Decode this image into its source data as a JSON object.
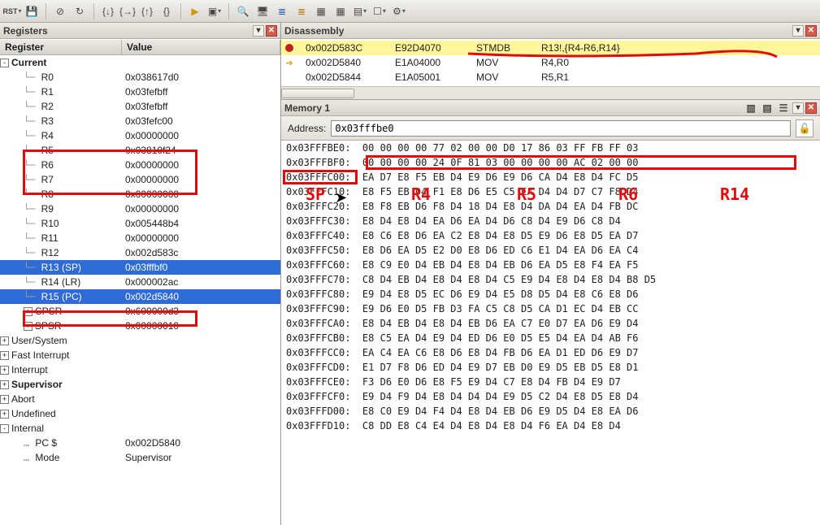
{
  "toolbar_icons": [
    "rst",
    "save",
    "stop",
    "sync",
    "step-into",
    "step-over",
    "step-out",
    "run-to",
    "play-dd",
    "box-dd",
    "search",
    "screen",
    "stack-blue",
    "stack-orange",
    "grid",
    "grid2",
    "table-dd",
    "window-dd",
    "gear-dd"
  ],
  "registers_panel": {
    "title": "Registers",
    "columns": {
      "register": "Register",
      "value": "Value"
    },
    "groups": [
      {
        "name": "Current",
        "expanded": true,
        "bold": true,
        "children": [
          {
            "name": "R0",
            "value": "0x038617d0"
          },
          {
            "name": "R1",
            "value": "0x03fefbff"
          },
          {
            "name": "R2",
            "value": "0x03fefbff"
          },
          {
            "name": "R3",
            "value": "0x03fefc00"
          },
          {
            "name": "R4",
            "value": "0x00000000"
          },
          {
            "name": "R5",
            "value": "0x03810f24"
          },
          {
            "name": "R6",
            "value": "0x00000000"
          },
          {
            "name": "R7",
            "value": "0x00000000"
          },
          {
            "name": "R8",
            "value": "0x00000000"
          },
          {
            "name": "R9",
            "value": "0x00000000"
          },
          {
            "name": "R10",
            "value": "0x005448b4"
          },
          {
            "name": "R11",
            "value": "0x00000000"
          },
          {
            "name": "R12",
            "value": "0x002d583c"
          },
          {
            "name": "R13 (SP)",
            "value": "0x03fffbf0",
            "sel": true
          },
          {
            "name": "R14 (LR)",
            "value": "0x000002ac"
          },
          {
            "name": "R15 (PC)",
            "value": "0x002d5840",
            "sel": true
          },
          {
            "name": "CPSR",
            "value": "0x600000d3",
            "exp": "+"
          },
          {
            "name": "SPSR",
            "value": "0x00000010",
            "exp": "+"
          }
        ]
      },
      {
        "name": "User/System",
        "expanded": false,
        "exp": "+",
        "prefix": "…"
      },
      {
        "name": "Fast Interrupt",
        "expanded": false,
        "exp": "+",
        "prefix": "…"
      },
      {
        "name": "Interrupt",
        "expanded": false,
        "exp": "+",
        "prefix": "…"
      },
      {
        "name": "Supervisor",
        "expanded": false,
        "exp": "+",
        "bold": true,
        "prefix": "…"
      },
      {
        "name": "Abort",
        "expanded": false,
        "exp": "+",
        "prefix": "…"
      },
      {
        "name": "Undefined",
        "expanded": false,
        "exp": "+",
        "prefix": "…"
      },
      {
        "name": "Internal",
        "expanded": true,
        "exp": "-",
        "children": [
          {
            "name": "PC $",
            "value": "0x002D5840",
            "prefix": "…"
          },
          {
            "name": "Mode",
            "value": "Supervisor",
            "prefix": "…"
          }
        ]
      }
    ]
  },
  "disassembly_panel": {
    "title": "Disassembly",
    "rows": [
      {
        "gutter": "brk",
        "addr": "0x002D583C",
        "bytes": "E92D4070",
        "mnem": "STMDB",
        "args": "R13!,{R4-R6,R14}",
        "hit": true
      },
      {
        "gutter": "arrow",
        "addr": "0x002D5840",
        "bytes": "E1A04000",
        "mnem": "MOV",
        "args": "R4,R0"
      },
      {
        "gutter": "",
        "addr": "0x002D5844",
        "bytes": "E1A05001",
        "mnem": "MOV",
        "args": "R5,R1"
      }
    ]
  },
  "memory_panel": {
    "title": "Memory 1",
    "address_label": "Address:",
    "address_value": "0x03fffbe0",
    "rows": [
      {
        "addr": "0x03FFFBE0",
        "hex": "00 00 00 00 77 02 00 00 D0 17 86 03 FF FB FF 03"
      },
      {
        "addr": "0x03FFFBF0",
        "hex": "00 00 00 00 24 0F 81 03 00 00 00 00 AC 02 00 00"
      },
      {
        "addr": "0x03FFFC00",
        "hex": "EA D7 E8 F5 EB D4 E9 D6 E9 D6 CA D4 E8 D4 FC D5"
      },
      {
        "addr": "0x03FFFC10",
        "hex": "E8 F5 EB D4 F1 E8 D6 E5 C5 EA D4 D4 D7 C7 F8 D4"
      },
      {
        "addr": "0x03FFFC20",
        "hex": "E8 F8 EB D6 F8 D4 18 D4 E8 D4 DA D4 EA D4 FB DC"
      },
      {
        "addr": "0x03FFFC30",
        "hex": "E8 D4 E8 D4 EA D6 EA D4 D6 C8 D4 E9 D6 C8 D4"
      },
      {
        "addr": "0x03FFFC40",
        "hex": "E8 C6 E8 D6 EA C2 E8 D4 E8 D5 E9 D6 E8 D5 EA D7"
      },
      {
        "addr": "0x03FFFC50",
        "hex": "E8 D6 EA D5 E2 D0 E8 D6 ED C6 E1 D4 EA D6 EA C4"
      },
      {
        "addr": "0x03FFFC60",
        "hex": "E8 C9 E0 D4 EB D4 E8 D4 EB D6 EA D5 E8 F4 EA F5"
      },
      {
        "addr": "0x03FFFC70",
        "hex": "C8 D4 EB D4 E8 D4 E8 D4 C5 E9 D4 E8 D4 E8 D4 B8 D5"
      },
      {
        "addr": "0x03FFFC80",
        "hex": "E9 D4 E8 D5 EC D6 E9 D4 E5 D8 D5 D4 E8 C6 E8 D6"
      },
      {
        "addr": "0x03FFFC90",
        "hex": "E9 D6 E0 D5 FB D3 FA C5 C8 D5 CA D1 EC D4 EB CC"
      },
      {
        "addr": "0x03FFFCA0",
        "hex": "E8 D4 EB D4 E8 D4 EB D6 EA C7 E0 D7 EA D6 E9 D4"
      },
      {
        "addr": "0x03FFFCB0",
        "hex": "E8 C5 EA D4 E9 D4 ED D6 E0 D5 E5 D4 EA D4 AB F6"
      },
      {
        "addr": "0x03FFFCC0",
        "hex": "EA C4 EA C6 E8 D6 E8 D4 FB D6 EA D1 ED D6 E9 D7"
      },
      {
        "addr": "0x03FFFCD0",
        "hex": "E1 D7 F8 D6 ED D4 E9 D7 EB D0 E9 D5 EB D5 E8 D1"
      },
      {
        "addr": "0x03FFFCE0",
        "hex": "F3 D6 E0 D6 E8 F5 E9 D4 C7 E8 D4 FB D4 E9 D7"
      },
      {
        "addr": "0x03FFFCF0",
        "hex": "E9 D4 F9 D4 E8 D4 D4 D4 E9 D5 C2 D4 E8 D5 E8 D4"
      },
      {
        "addr": "0x03FFFD00",
        "hex": "E8 C0 E9 D4 F4 D4 E8 D4 EB D6 E9 D5 D4 E8 EA D6"
      },
      {
        "addr": "0x03FFFD10",
        "hex": "C8 DD E8 C4 E4 D4 E8 D4 E8 D4 F6 EA D4 E8 D4"
      }
    ]
  },
  "annotations": {
    "reg_boxes": [
      {
        "id": "r4r6-box"
      },
      {
        "id": "r14-box"
      },
      {
        "id": "sp-addr-box"
      },
      {
        "id": "mem-row2-box"
      }
    ],
    "labels": [
      "SP",
      "R4",
      "R5",
      "R6",
      "R14"
    ]
  }
}
